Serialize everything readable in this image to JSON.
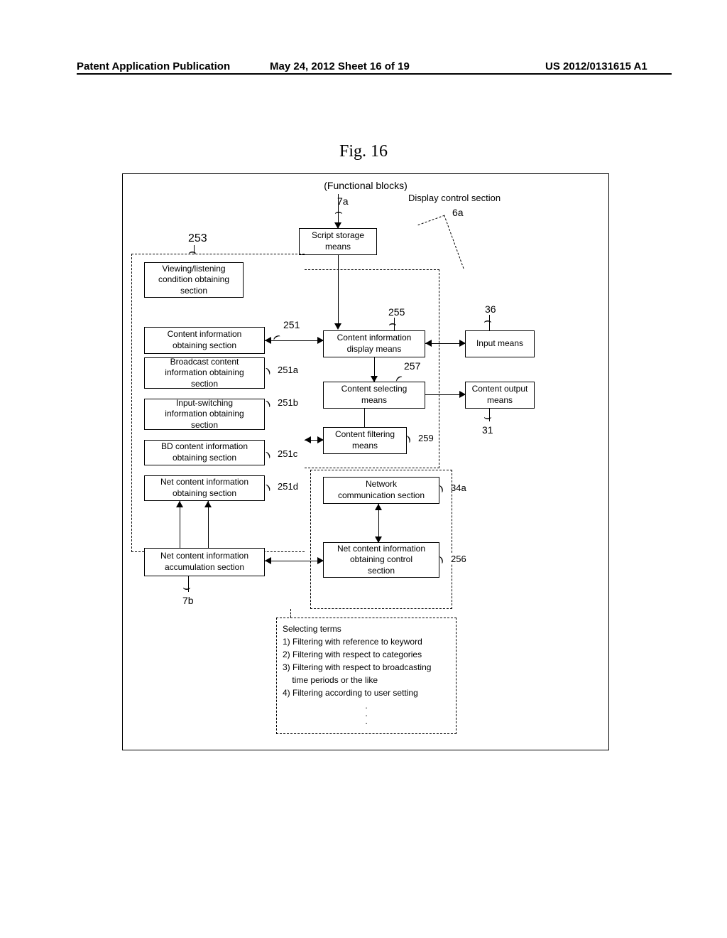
{
  "header": {
    "left": "Patent Application Publication",
    "mid": "May 24, 2012  Sheet 16 of 19",
    "right": "US 2012/0131615 A1"
  },
  "fig_title": "Fig. 16",
  "block_title": "(Functional blocks)",
  "labels": {
    "l253": "253",
    "l7a": "7a",
    "l6a": "6a",
    "l255": "255",
    "l36": "36",
    "l251": "251",
    "l257": "257",
    "l251a": "251a",
    "l251b": "251b",
    "l251c": "251c",
    "l251d": "251d",
    "l259": "259",
    "l31": "31",
    "l34a": "34a",
    "l256": "256",
    "l7b": "7b",
    "display_control": "Display control section"
  },
  "boxes": {
    "script_storage": "Script storage\nmeans",
    "viewing_listening": "Viewing/listening\ncondition obtaining\nsection",
    "content_info_obtaining": "Content information\nobtaining section",
    "broadcast_content": "Broadcast content\ninformation obtaining\nsection",
    "input_switching": "Input-switching\ninformation obtaining\nsection",
    "bd_content": "BD content information\nobtaining section",
    "net_content_obtaining": "Net content information\nobtaining section",
    "content_info_display": "Content information\ndisplay means",
    "input_means": "Input means",
    "content_selecting": "Content selecting\nmeans",
    "content_output": "Content output\nmeans",
    "content_filtering": "Content filtering\nmeans",
    "network_comm": "Network\ncommunication section",
    "net_content_accum": "Net content information\naccumulation section",
    "net_content_control": "Net content information\nobtaining control\nsection"
  },
  "terms": {
    "heading": "Selecting terms",
    "item1": "1) Filtering with reference to keyword",
    "item2": "2) Filtering with respect to categories",
    "item3": "3) Filtering with respect to broadcasting",
    "item3b": "    time periods or the like",
    "item4": "4) Filtering according to user setting"
  }
}
